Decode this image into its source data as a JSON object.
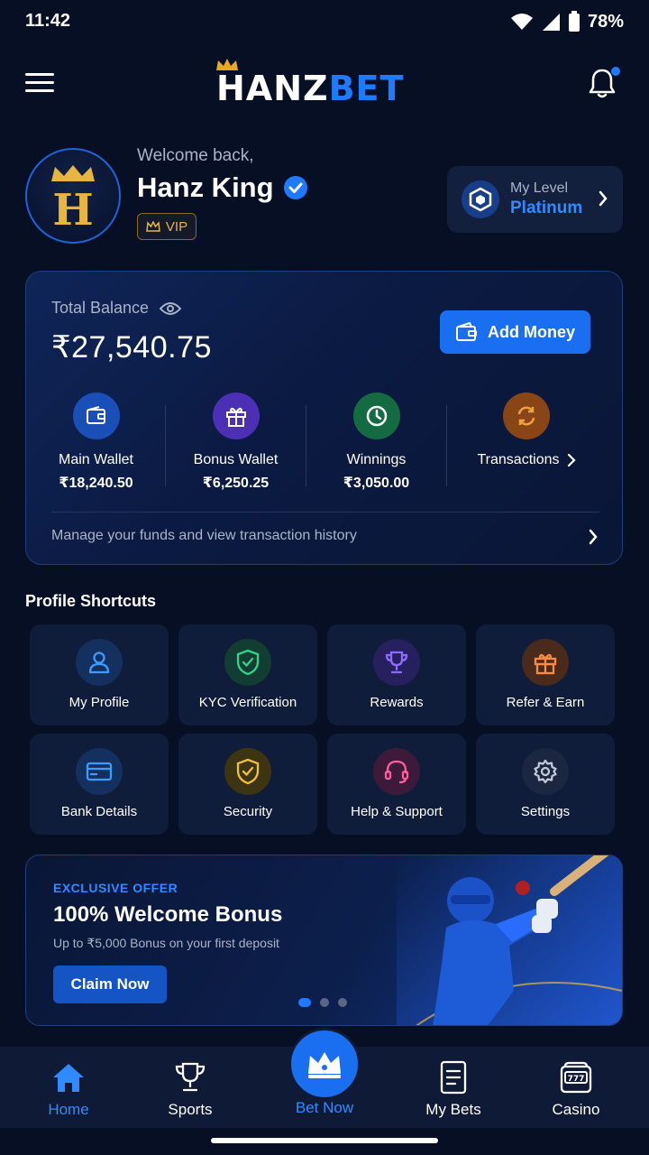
{
  "status_bar": {
    "time": "11:42",
    "battery": "78%"
  },
  "header": {
    "logo_hanz": "HANZ",
    "logo_bet": "BET"
  },
  "profile": {
    "welcome": "Welcome back,",
    "name": "Hanz King",
    "avatar_letter": "H",
    "badge": "VIP",
    "level_label": "My Level",
    "level_value": "Platinum"
  },
  "balance": {
    "label": "Total Balance",
    "amount": "₹27,540.75",
    "add_money": "Add Money",
    "wallets": [
      {
        "name": "Main Wallet",
        "value": "₹18,240.50"
      },
      {
        "name": "Bonus Wallet",
        "value": "₹6,250.25"
      },
      {
        "name": "Winnings",
        "value": "₹3,050.00"
      },
      {
        "name": "Transactions",
        "value": ""
      }
    ],
    "footer": "Manage your funds and view transaction history"
  },
  "shortcuts": {
    "title": "Profile Shortcuts",
    "items": [
      {
        "label": "My Profile",
        "icon": "user-icon"
      },
      {
        "label": "KYC Verification",
        "icon": "shield-check-icon"
      },
      {
        "label": "Rewards",
        "icon": "trophy-icon"
      },
      {
        "label": "Refer & Earn",
        "icon": "gift-icon"
      },
      {
        "label": "Bank Details",
        "icon": "card-icon"
      },
      {
        "label": "Security",
        "icon": "shield-icon"
      },
      {
        "label": "Help & Support",
        "icon": "headset-icon"
      },
      {
        "label": "Settings",
        "icon": "gear-icon"
      }
    ]
  },
  "offer": {
    "tag": "EXCLUSIVE OFFER",
    "title": "100% Welcome Bonus",
    "subtitle": "Up to ₹5,000 Bonus on your first deposit",
    "button": "Claim Now",
    "active_slide": 1,
    "slide_count": 3
  },
  "nav": {
    "home": "Home",
    "sports": "Sports",
    "bet_now": "Bet Now",
    "my_bets": "My Bets",
    "casino": "Casino"
  },
  "colors": {
    "background": "#070f24",
    "accent": "#1e7bff",
    "gold": "#e8b540"
  }
}
